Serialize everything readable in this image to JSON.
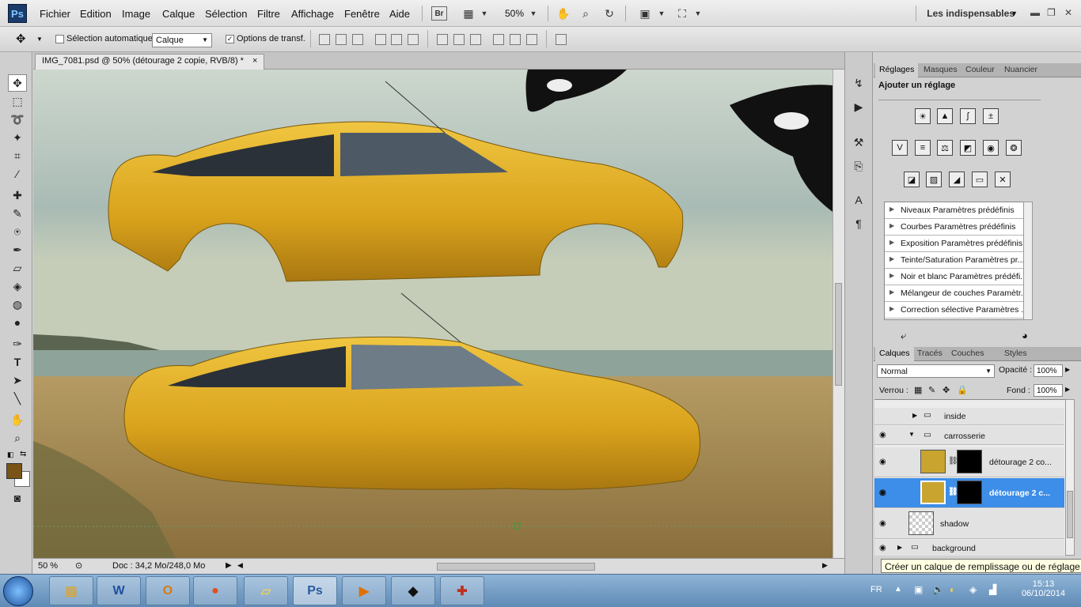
{
  "menubar": {
    "logo": "Ps",
    "items": [
      "Fichier",
      "Edition",
      "Image",
      "Calque",
      "Sélection",
      "Filtre",
      "Affichage",
      "Fenêtre",
      "Aide"
    ],
    "br_label": "Br",
    "zoom": "50%",
    "workspace": "Les indispensables"
  },
  "options": {
    "auto_select_label": "Sélection automatique :",
    "auto_select_checked": false,
    "auto_select_target": "Calque",
    "transform_label": "Options de transf.",
    "transform_checked": true
  },
  "document": {
    "tab_title": "IMG_7081.psd @ 50% (détourage 2 copie, RVB/8) *",
    "close_glyph": "×"
  },
  "status": {
    "zoom": "50 %",
    "doc_info": "Doc : 34,2 Mo/248,0 Mo"
  },
  "adjustments": {
    "tabs": [
      "Réglages",
      "Masques",
      "Couleur",
      "Nuancier"
    ],
    "heading": "Ajouter un réglage",
    "presets": [
      "Niveaux Paramètres prédéfinis",
      "Courbes Paramètres prédéfinis",
      "Exposition Paramètres prédéfinis",
      "Teinte/Saturation Paramètres pr...",
      "Noir et blanc Paramètres prédéfi...",
      "Mélangeur de couches Paramètr...",
      "Correction sélective Paramètres ..."
    ]
  },
  "layers": {
    "tabs": [
      "Calques",
      "Tracés",
      "Couches",
      "Styles"
    ],
    "blend_mode": "Normal",
    "opacity_label": "Opacité :",
    "opacity": "100%",
    "lock_label": "Verrou :",
    "fill_label": "Fond :",
    "fill": "100%",
    "rows": [
      {
        "name": "inside",
        "type": "group"
      },
      {
        "name": "carrosserie",
        "type": "group"
      },
      {
        "name": "détourage 2 co...",
        "type": "layer"
      },
      {
        "name": "détourage 2 c...",
        "type": "layer",
        "selected": true
      },
      {
        "name": "shadow",
        "type": "layer"
      },
      {
        "name": "background",
        "type": "group"
      }
    ]
  },
  "tooltip": "Créer un calque de remplissage ou de réglage",
  "taskbar": {
    "lang": "FR",
    "time": "15:13",
    "date": "06/10/2014"
  }
}
